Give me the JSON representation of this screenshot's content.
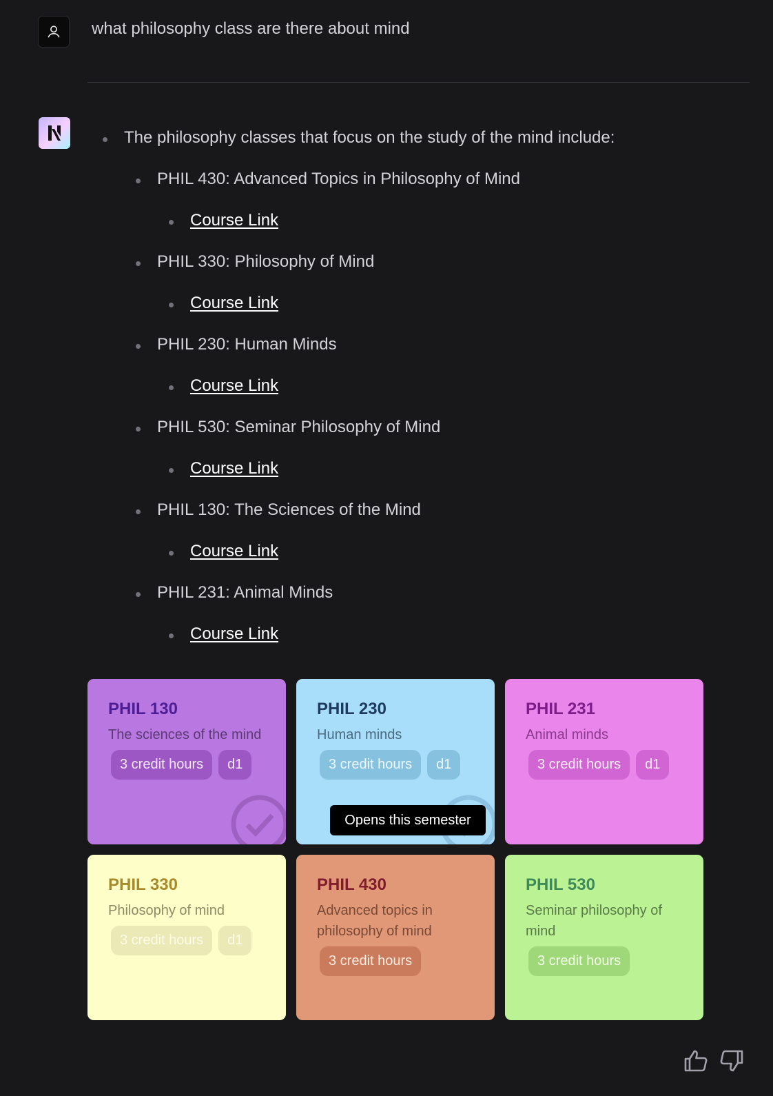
{
  "conversation": {
    "user_message": "what philosophy class are there about mind",
    "answer_intro": "The philosophy classes that focus on the study of the mind include:",
    "courses_list": [
      {
        "title": "PHIL 430: Advanced Topics in Philosophy of Mind",
        "link_label": "Course Link"
      },
      {
        "title": "PHIL 330: Philosophy of Mind",
        "link_label": "Course Link"
      },
      {
        "title": "PHIL 230: Human Minds",
        "link_label": "Course Link"
      },
      {
        "title": "PHIL 530: Seminar Philosophy of Mind",
        "link_label": "Course Link"
      },
      {
        "title": "PHIL 130: The Sciences of the Mind",
        "link_label": "Course Link"
      },
      {
        "title": "PHIL 231: Animal Minds",
        "link_label": "Course Link"
      }
    ]
  },
  "cards": [
    {
      "code": "PHIL 130",
      "name": "The sciences of the mind",
      "credits": "3 credit hours",
      "tag": "d1",
      "bg": "#b977e1",
      "code_color": "#4c1d95",
      "name_color": "#5b3b73",
      "badge_bg": "#9d57c4",
      "badge_fg": "#f3e8ff"
    },
    {
      "code": "PHIL 230",
      "name": "Human minds",
      "credits": "3 credit hours",
      "tag": "d1",
      "bg": "#a9defb",
      "code_color": "#1e3a5f",
      "name_color": "#4a6a80",
      "badge_bg": "#86c1e0",
      "badge_fg": "#eef8ff"
    },
    {
      "code": "PHIL 231",
      "name": "Animal minds",
      "credits": "3 credit hours",
      "tag": "d1",
      "bg": "#e985eb",
      "code_color": "#7e1c8a",
      "name_color": "#8a3b8c",
      "badge_bg": "#d065d3",
      "badge_fg": "#fdeefe"
    },
    {
      "code": "PHIL 330",
      "name": "Philosophy of mind",
      "credits": "3 credit hours",
      "tag": "d1",
      "bg": "#fdfec8",
      "code_color": "#a88a2a",
      "name_color": "#8f8a66",
      "badge_bg": "#ebe9b6",
      "badge_fg": "#fbfbe8"
    },
    {
      "code": "PHIL 430",
      "name": "Advanced topics in philosophy of mind",
      "credits": "3 credit hours",
      "tag": "",
      "bg": "#e09877",
      "code_color": "#7f1d2d",
      "name_color": "#7a4a38",
      "badge_bg": "#c97b5b",
      "badge_fg": "#fdebe2"
    },
    {
      "code": "PHIL 530",
      "name": "Seminar philosophy of mind",
      "credits": "3 credit hours",
      "tag": "",
      "bg": "#bbf293",
      "code_color": "#3f8a5a",
      "name_color": "#5a7a4a",
      "badge_bg": "#9fd878",
      "badge_fg": "#f2fde8"
    }
  ],
  "tooltip": "Opens this semester",
  "icons": {
    "user": "user-icon",
    "bot": "bot-logo-icon",
    "check": "check-circle-icon",
    "thumbs_up": "thumbs-up-icon",
    "thumbs_down": "thumbs-down-icon"
  }
}
